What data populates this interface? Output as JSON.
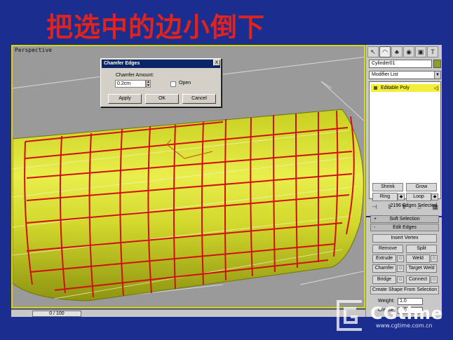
{
  "slide": {
    "title": "把选中的边小倒下"
  },
  "viewport": {
    "label": "Perspective"
  },
  "timeline": {
    "slider": "0 / 100"
  },
  "dialog": {
    "title": "Chamfer Edges",
    "close": "X",
    "amount_label": "Chamfer Amount:",
    "amount_value": "0.2cm",
    "open_label": "Open",
    "apply": "Apply",
    "ok": "OK",
    "cancel": "Cancel"
  },
  "panel": {
    "object_name": "Cylinder01",
    "object_color": "#8aa31f",
    "modifier_list": "Modifier List",
    "stack_item": "Editable Poly",
    "selection": {
      "shrink": "Shrink",
      "grow": "Grow",
      "ring": "Ring",
      "loop": "Loop",
      "info": "2196 Edges Selected"
    },
    "soft_selection": {
      "sign": "+",
      "label": "Soft Selection"
    },
    "edit_edges": {
      "sign": "-",
      "label": "Edit Edges",
      "insert_vertex": "Insert Vertex",
      "remove": "Remove",
      "split": "Split",
      "extrude": "Extrude",
      "weld": "Weld",
      "chamfer": "Chamfer",
      "target_weld": "Target Weld",
      "bridge": "Bridge",
      "connect": "Connect",
      "create_shape": "Create Shape From Selection",
      "weight_label": "Weight:",
      "weight_value": "1.0",
      "crease_label": "Crease:",
      "crease_value": "0.0"
    }
  },
  "branding": {
    "name": "CGtime",
    "url": "www.cgtime.com.cn"
  },
  "colors": {
    "background": "#1b2d8e",
    "title": "#e0231c",
    "edge_select": "#d01010",
    "mesh": "#d4dc2c",
    "highlight": "#f3ee3a"
  }
}
